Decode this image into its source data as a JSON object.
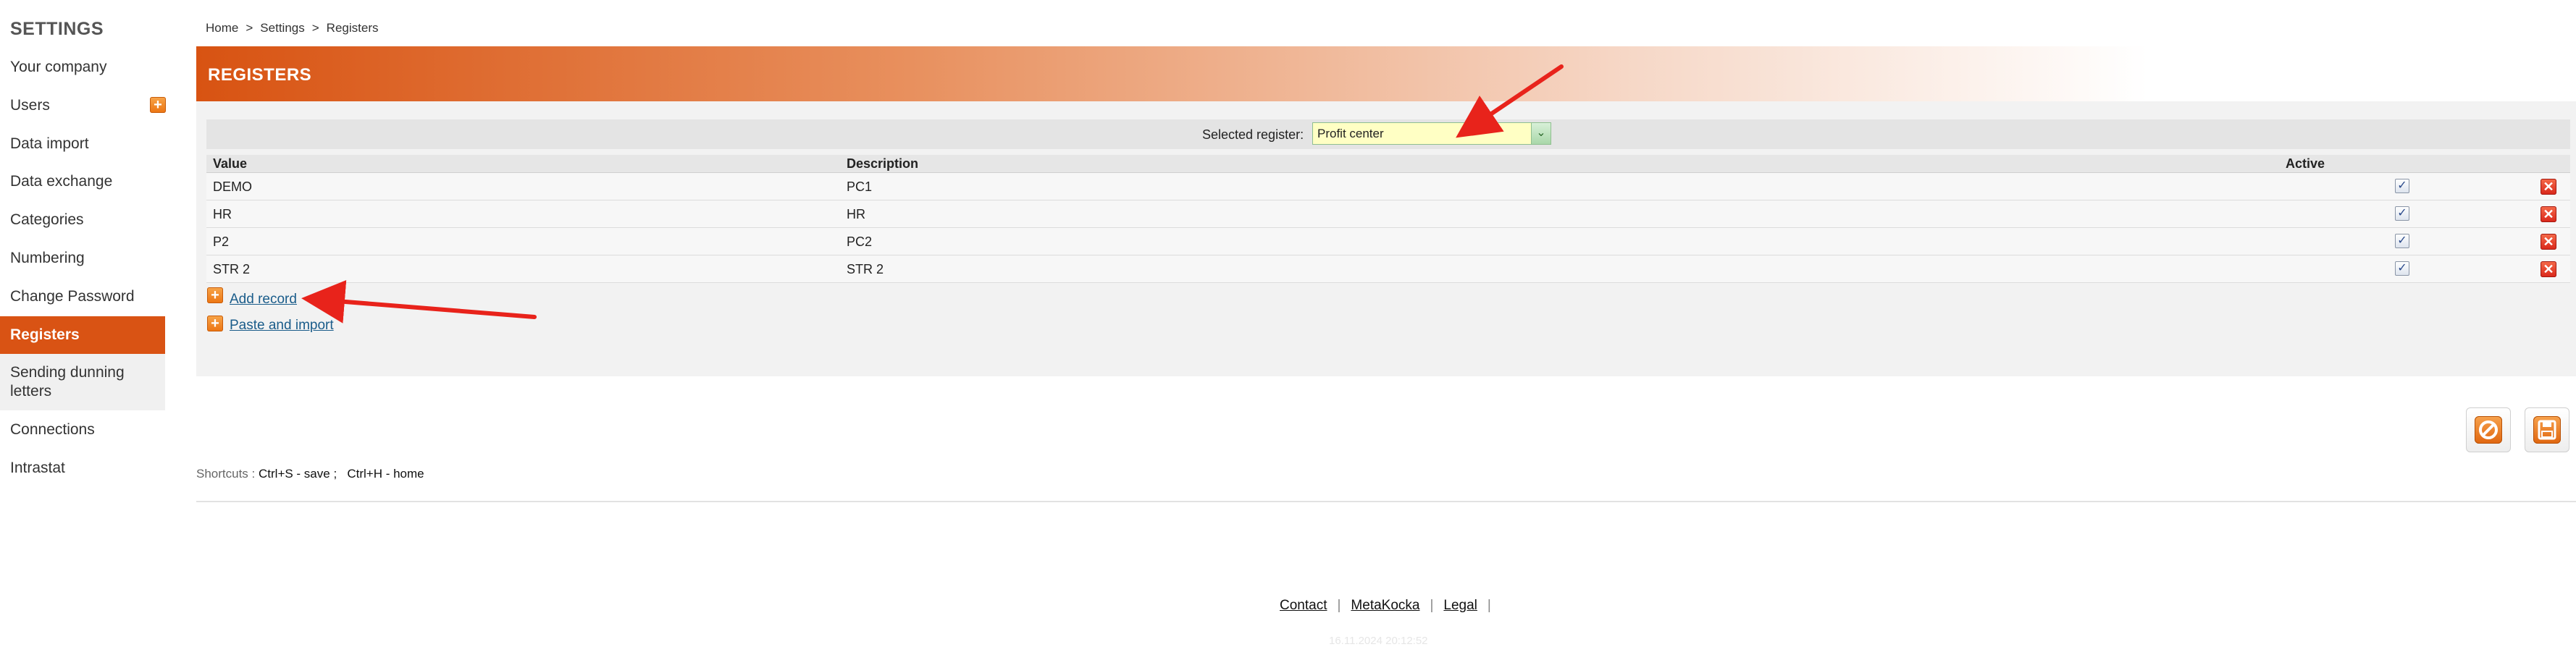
{
  "sidebar": {
    "title": "SETTINGS",
    "items": [
      {
        "label": "Your company"
      },
      {
        "label": "Users"
      },
      {
        "label": "Data import"
      },
      {
        "label": "Data exchange"
      },
      {
        "label": "Categories"
      },
      {
        "label": "Numbering"
      },
      {
        "label": "Change Password"
      },
      {
        "label": "Registers",
        "active": true
      },
      {
        "label": "Sending dunning letters"
      },
      {
        "label": "Connections"
      },
      {
        "label": "Intrastat"
      }
    ],
    "users_add_icon": "plus-icon"
  },
  "breadcrumb": [
    "Home",
    "Settings",
    "Registers"
  ],
  "breadcrumb_separator": ">",
  "header": {
    "title": "REGISTERS"
  },
  "register": {
    "label": "Selected register:",
    "selected": "Profit center"
  },
  "table": {
    "columns": [
      "Value",
      "Description",
      "Active"
    ],
    "rows": [
      {
        "value": "DEMO",
        "description": "PC1",
        "active": true
      },
      {
        "value": "HR",
        "description": "HR",
        "active": true
      },
      {
        "value": "P2",
        "description": "PC2",
        "active": true
      },
      {
        "value": "STR 2",
        "description": "STR 2",
        "active": true
      }
    ]
  },
  "actions": {
    "add_record": "Add record",
    "paste_import": "Paste and import"
  },
  "shortcuts": {
    "label": "Shortcuts :",
    "save": "Ctrl+S - save ;",
    "home": "Ctrl+H - home"
  },
  "footer": {
    "links": [
      "Contact",
      "MetaKocka",
      "Legal"
    ],
    "timestamp": "16.11.2024 20:12:52"
  },
  "colors": {
    "accent": "#d95314",
    "select_bg": "#ffffc4",
    "delete": "#d9261a"
  }
}
